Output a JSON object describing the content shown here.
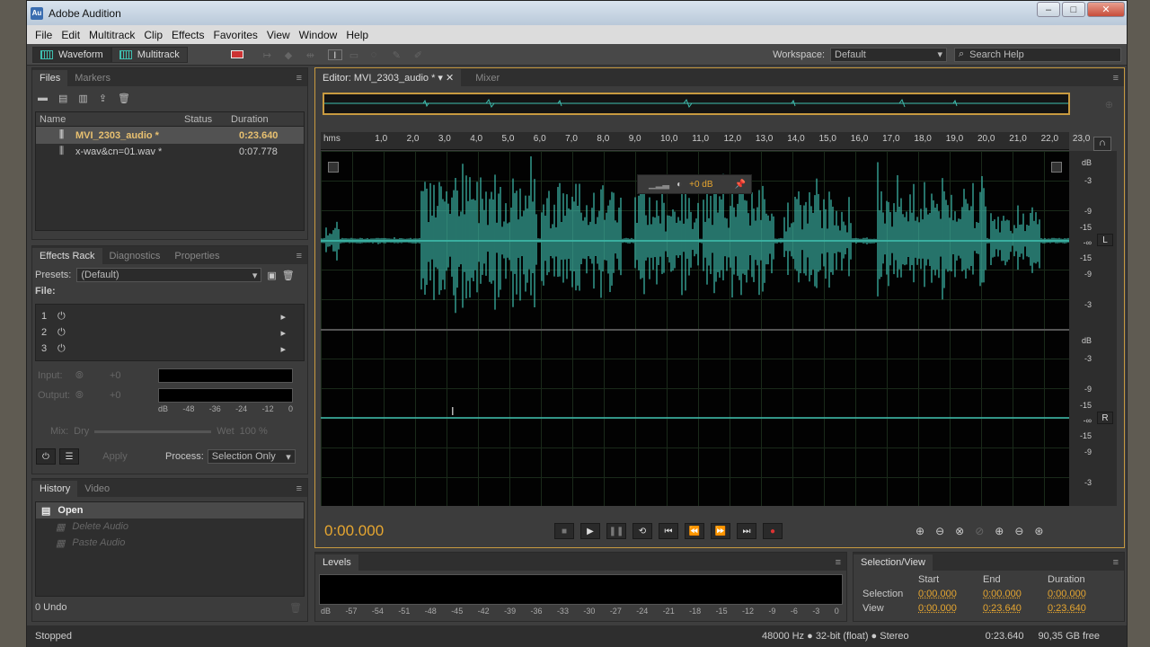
{
  "app": {
    "title": "Adobe Audition",
    "icon_text": "Au"
  },
  "menu": [
    "File",
    "Edit",
    "Multitrack",
    "Clip",
    "Effects",
    "Favorites",
    "View",
    "Window",
    "Help"
  ],
  "toolbar": {
    "waveform": "Waveform",
    "multitrack": "Multitrack",
    "workspace_label": "Workspace:",
    "workspace_value": "Default",
    "search_placeholder": "Search Help"
  },
  "files": {
    "tabs": [
      "Files",
      "Markers"
    ],
    "col_name": "Name",
    "col_status": "Status",
    "col_duration": "Duration",
    "rows": [
      {
        "name": "MVI_2303_audio *",
        "duration": "0:23.640"
      },
      {
        "name": "x-wav&cn=01.wav *",
        "duration": "0:07.778"
      }
    ]
  },
  "effects": {
    "tabs": [
      "Effects Rack",
      "Diagnostics",
      "Properties"
    ],
    "presets_label": "Presets:",
    "presets_value": "(Default)",
    "file_label": "File:",
    "slots": [
      "1",
      "2",
      "3"
    ],
    "input_label": "Input:",
    "output_label": "Output:",
    "mix_label": "Mix:",
    "dry": "Dry",
    "wet": "Wet",
    "mix_pct": "100 %",
    "scale": [
      "dB",
      "-48",
      "-36",
      "-24",
      "-12",
      "0"
    ],
    "apply": "Apply",
    "process_label": "Process:",
    "process_value": "Selection Only",
    "input_db": "+0",
    "output_db": "+0"
  },
  "history": {
    "tabs": [
      "History",
      "Video"
    ],
    "items": [
      "Open",
      "Delete Audio",
      "Paste Audio"
    ],
    "undo": "0 Undo"
  },
  "editor": {
    "tab": "Editor: MVI_2303_audio *",
    "mixer": "Mixer",
    "gain": "+0 dB",
    "time": "0:00.000",
    "channels": [
      "L",
      "R"
    ],
    "ruler": [
      "hms",
      "1,0",
      "2,0",
      "3,0",
      "4,0",
      "5,0",
      "6,0",
      "7,0",
      "8,0",
      "9,0",
      "10,0",
      "11,0",
      "12,0",
      "13,0",
      "14,0",
      "15,0",
      "16,0",
      "17,0",
      "18,0",
      "19,0",
      "20,0",
      "21,0",
      "22,0",
      "23,0"
    ],
    "db_scale": [
      "dB",
      "-3",
      "-9",
      "-15",
      "-∞",
      "-15",
      "-9",
      "-3"
    ]
  },
  "levels": {
    "tab": "Levels",
    "scale": [
      "dB",
      "-57",
      "-54",
      "-51",
      "-48",
      "-45",
      "-42",
      "-39",
      "-36",
      "-33",
      "-30",
      "-27",
      "-24",
      "-21",
      "-18",
      "-15",
      "-12",
      "-9",
      "-6",
      "-3",
      "0"
    ]
  },
  "selection": {
    "tab": "Selection/View",
    "start": "Start",
    "end": "End",
    "duration": "Duration",
    "selection": "Selection",
    "view": "View",
    "sel_start": "0:00.000",
    "sel_end": "0:00.000",
    "sel_dur": "0:00.000",
    "view_start": "0:00.000",
    "view_end": "0:23.640",
    "view_dur": "0:23.640"
  },
  "status": {
    "state": "Stopped",
    "format": "48000 Hz ● 32-bit (float) ● Stereo",
    "length": "0:23.640",
    "free": "90,35 GB free"
  },
  "colors": {
    "wave": "#3fbfb0",
    "accent": "#e6a630"
  }
}
